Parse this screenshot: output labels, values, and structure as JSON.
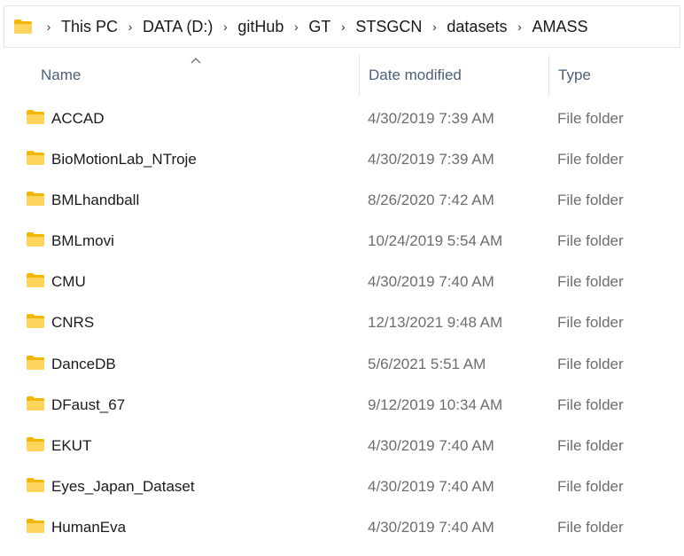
{
  "breadcrumb": {
    "items": [
      {
        "label": "This PC"
      },
      {
        "label": "DATA (D:)"
      },
      {
        "label": "gitHub"
      },
      {
        "label": "GT"
      },
      {
        "label": "STSGCN"
      },
      {
        "label": "datasets"
      },
      {
        "label": "AMASS"
      }
    ]
  },
  "columns": {
    "name": "Name",
    "date_modified": "Date modified",
    "type": "Type",
    "sort": "name-ascending"
  },
  "icons": {
    "folder_color": "#ffd45c",
    "folder_dark": "#f2b705"
  },
  "files": [
    {
      "name": "ACCAD",
      "date": "4/30/2019 7:39 AM",
      "type": "File folder"
    },
    {
      "name": "BioMotionLab_NTroje",
      "date": "4/30/2019 7:39 AM",
      "type": "File folder"
    },
    {
      "name": "BMLhandball",
      "date": "8/26/2020 7:42 AM",
      "type": "File folder"
    },
    {
      "name": "BMLmovi",
      "date": "10/24/2019 5:54 AM",
      "type": "File folder"
    },
    {
      "name": "CMU",
      "date": "4/30/2019 7:40 AM",
      "type": "File folder"
    },
    {
      "name": "CNRS",
      "date": "12/13/2021 9:48 AM",
      "type": "File folder"
    },
    {
      "name": "DanceDB",
      "date": "5/6/2021 5:51 AM",
      "type": "File folder"
    },
    {
      "name": "DFaust_67",
      "date": "9/12/2019 10:34 AM",
      "type": "File folder"
    },
    {
      "name": "EKUT",
      "date": "4/30/2019 7:40 AM",
      "type": "File folder"
    },
    {
      "name": "Eyes_Japan_Dataset",
      "date": "4/30/2019 7:40 AM",
      "type": "File folder"
    },
    {
      "name": "HumanEva",
      "date": "4/30/2019 7:40 AM",
      "type": "File folder"
    }
  ]
}
